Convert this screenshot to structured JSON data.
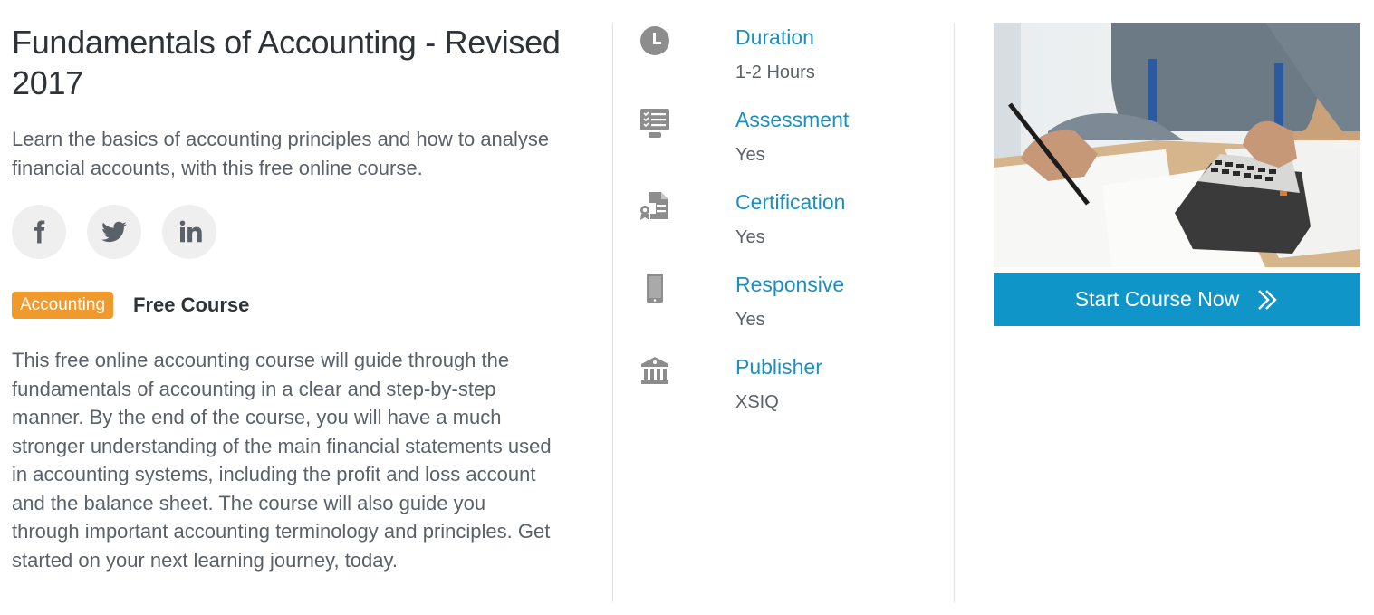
{
  "course": {
    "title": "Fundamentals of Accounting - Revised 2017",
    "subtitle": "Learn the basics of accounting principles and how to analyse financial accounts, with this free online course.",
    "category_tag": "Accounting",
    "price_label": "Free Course",
    "description": "This free online accounting course will guide through the fundamentals of accounting in a clear and step-by-step manner. By the end of the course, you will have a much stronger understanding of the main financial statements used in accounting systems, including the profit and loss account and the balance sheet. The course will also guide you through important accounting terminology and principles. Get started on your next learning journey, today."
  },
  "social": [
    {
      "name": "facebook",
      "icon": "facebook-icon"
    },
    {
      "name": "twitter",
      "icon": "twitter-icon"
    },
    {
      "name": "linkedin",
      "icon": "linkedin-icon"
    }
  ],
  "details": [
    {
      "label": "Duration",
      "value": "1-2 Hours",
      "icon": "clock-icon"
    },
    {
      "label": "Assessment",
      "value": "Yes",
      "icon": "assessment-icon"
    },
    {
      "label": "Certification",
      "value": "Yes",
      "icon": "certificate-icon"
    },
    {
      "label": "Responsive",
      "value": "Yes",
      "icon": "mobile-icon"
    },
    {
      "label": "Publisher",
      "value": "XSIQ",
      "icon": "institution-icon"
    }
  ],
  "sidebar": {
    "image_alt": "Person using calculator with financial papers",
    "cta_label": "Start Course Now"
  },
  "colors": {
    "accent_blue": "#1095c9",
    "label_blue": "#1b8fc0",
    "tag_orange": "#f0992d"
  }
}
